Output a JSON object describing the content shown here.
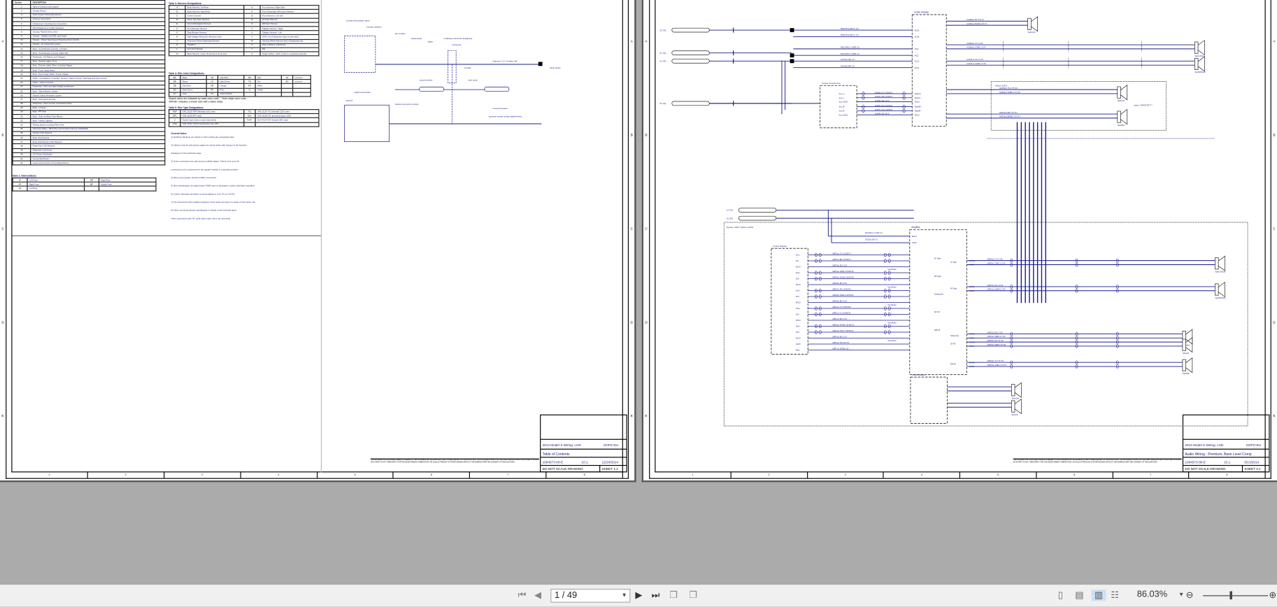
{
  "viewer": {
    "page_display": "1 / 49",
    "zoom": "86.03%"
  },
  "zones": [
    "1",
    "2",
    "3",
    "4",
    "5",
    "6",
    "7",
    "8"
  ],
  "rows": [
    "A",
    "B",
    "C",
    "D",
    "E"
  ],
  "sheet1": {
    "toc_headers": [
      "Section",
      "DESCRIPTION"
    ],
    "toc": [
      [
        "1",
        "Table of Contents and Legend"
      ],
      [
        "2",
        "Change History"
      ],
      [
        "3",
        "Audio System Wiring (all options)"
      ],
      [
        "5",
        "Antenna connections"
      ],
      [
        "6",
        "Infotainment main/Antenna connections"
      ],
      [
        "7",
        "MCU/Infotainment vehicle interfaces"
      ],
      [
        "8",
        "Security, Passive Entry, Horn"
      ],
      [
        "9",
        "Chassis - Stability and ABS, park brake"
      ],
      [
        "10",
        "Chassis - Power Steering and Steering wheel controls"
      ],
      [
        "11",
        "Chassis - Air suspension system"
      ],
      [
        "12",
        "Body - Door/Window Controls, Left Side"
      ],
      [
        "14",
        "Body - Door/Window Controls, Right Side"
      ],
      [
        "16",
        "Powertrain - HV Battery and Chargers"
      ],
      [
        "17",
        "Body - Exterior Lights, Front"
      ],
      [
        "18",
        "Body - Exterior Lights, Rear, including Tailgate"
      ],
      [
        "19",
        "Body - Front Cargo Hatch"
      ],
      [
        "20",
        "Body - Rear Cargo Hatch / Power Liftgate"
      ],
      [
        "21",
        "HVAC - Foundations: Controller, Sensors, Valves, Pumps, Solenoids and Inlet Louvers"
      ],
      [
        "22",
        "HVAC - Cabin Functions"
      ],
      [
        "24",
        "Powertrain - HVIL and High Voltage architecture"
      ],
      [
        "25",
        "Body - Wiper/Washer System"
      ],
      [
        "26",
        "Passive Safety Restraints System"
      ],
      [
        "27",
        "Body - Panoramic Sunroof"
      ],
      [
        "28",
        "Powertrain - Drive Inverter, Accelerator Pedal"
      ],
      [
        "29",
        "Body - LF Seat"
      ],
      [
        "30",
        "Body - RF Seat"
      ],
      [
        "31",
        "Body - Side and Rear View Mirrors"
      ],
      [
        "32",
        "Body - Interior Lighting"
      ],
      [
        "33",
        "Parking System including Rear View"
      ],
      [
        "34",
        "Advanced Safety - Blind Zone and Forward Camera, Park/Radar"
      ],
      [
        "35",
        "Chassis CAN Network"
      ],
      [
        "36",
        "Body CAN Network"
      ],
      [
        "37",
        "Body Fault/Tolerant CAN Network"
      ],
      [
        "38",
        "PowerTrain CAN Network"
      ],
      [
        "39",
        "Diagnostic Connectors"
      ],
      [
        "40",
        "12V Power Distribution"
      ],
      [
        "42",
        "Ground Distribution"
      ],
      [
        "43",
        "Layout and Function of Fuse/Relay Boxes"
      ]
    ],
    "abbr_caption": "Table 2: Abbreviations",
    "abbr": [
      [
        "LF",
        "Left Front",
        "RR",
        "Right Rear"
      ],
      [
        "RF",
        "Right Front",
        "MF",
        "Middle Front"
      ],
      [
        "LR",
        "Left Rear",
        "",
        ""
      ]
    ],
    "harness_caption": "Table 3: Harness Designations",
    "harness": [
      [
        "A",
        "Body Harness, Left Rear",
        "N",
        "Front Harness, Right Side"
      ],
      [
        "B",
        "Body Harness, Right Rear",
        "P",
        "Front Passenger (RF) Door Harness"
      ],
      [
        "C",
        "Center Console",
        "Q",
        "Front Harness, Left side"
      ],
      [
        "D",
        "Driver (LF) Door Harness",
        "R",
        "LR Door Harness"
      ],
      [
        "E",
        "Sunroof/Sideglass Harness",
        "S",
        "RR Door Harness"
      ],
      [
        "F",
        "Front Bumper Harness",
        "T",
        "Tailgate Harness - Right"
      ],
      [
        "G",
        "Rear Bumper Harness",
        "U",
        "Tailgate Harness - Left"
      ],
      [
        "H",
        "High Voltage Wiring (for reference only)",
        "V",
        "HVAC Unit Subharness (part of assembly)"
      ],
      [
        "J",
        "Instrument Panel (Dashpad) Harness",
        "W",
        "Steering Wheel Harness (from Clockspring out)"
      ],
      [
        "K",
        "Headliner",
        "X",
        "Rear subframe subharness"
      ],
      [
        "L",
        "Front End Module",
        "Y",
        "Bat"
      ],
      [
        "M",
        "Main Harness, Lower IP and Front Trunk area",
        "Z",
        "Single Cables - Each circuit in a separate assembly"
      ]
    ],
    "color_caption": "Table 4: Wire Color Designations",
    "colors": [
      [
        "BK",
        "Black",
        "LB",
        "Light Blue",
        "RD",
        "Red",
        "VA",
        "xxxxxxxx"
      ],
      [
        "BR",
        "Brown",
        "LG",
        "Light Green",
        "TN",
        "Tan",
        "SH",
        "xxxxxxxx"
      ],
      [
        "DB",
        "Dark Blue",
        "OR",
        "Orange",
        "WT",
        "White",
        "",
        ""
      ],
      [
        "DG",
        "Dark Green",
        "PK",
        "Pink",
        "YL",
        "Yellow",
        "",
        ""
      ],
      [
        "GY",
        "Gray",
        "VT",
        "Violet (Purple)",
        "",
        "",
        "",
        ""
      ]
    ],
    "stripe_note": [
      "Striped wires are indicated by base-color code \"-\" then stripe color code.",
      "\"BR-BK\" indicates a brown wire with a black stripe."
    ],
    "tags_caption": "Table 5: Wire Type Designations",
    "tags": [
      [
        "TWP",
        "SAE J1128 TWP (thinwall) 105C rated",
        "TXL",
        "SAE J1128 TXL (thinwall) 125C rated"
      ],
      [
        "SPC",
        "SAE J1128 SPC rated",
        "GXL",
        "SAE J1128 GXL general purpose 125C"
      ],
      [
        "S",
        "Double layer (twist on pair) braid shield",
        "FLRY",
        "ISO 6722 FLRY thinwall 105C rated"
      ],
      [
        "CAN",
        "SAE J2411 CAN-B specification wire, 85C",
        "",
        ""
      ]
    ],
    "notes_title": "General Notes",
    "notes": [
      "1) Switches (Relays) are shown in their resting (de-energized) state.",
      "2) Options may be split across pages for visual clarity with respect to the function",
      "    displayed on the particular page.",
      "3) Some connectors are split across multiple pages. Check to be sure all",
      "    connectors to be connected for the signals needed in a specific problem.",
      "4) Wire cross-section (mm2) to AWG conversion:",
      "5) Wire identification for twisted pair (TWP) type or equivalent, unless otherwise specified.",
      "6) Unless otherwise specified, terminal plating is to be Tin on Tin/Tin.",
      "7) For connectors with multiple instances of the same pin plug in a cavity on the same row.",
      "8) Inline connector gender specification is based on the terminal types.",
      "    Inline connectors with \"M\" suffix have male, tab or pin terminals."
    ],
    "legend": [
      "module description name",
      "module (outline)",
      "pin number",
      "twisted pair",
      "splice",
      "multiway connector designator",
      "connector",
      "module",
      "Harness C-C: N-Inline Tail",
      "inline splice",
      "shield connection",
      "Global connector number",
      "circuit number",
      "wire color",
      "Ground location",
      "ground",
      "optional content inside dashed lines"
    ],
    "title_block": {
      "project": "2013 Model S Wiring: LHD",
      "model": "SOP2+EU",
      "subject": "Table of Contents",
      "doc": "1004573-00-E",
      "rev": "10.1",
      "date": "12/24/2014",
      "noscale": "DO NOT SCALE DRAWING",
      "sheet": "SHEET 1.1"
    },
    "disclaimer": "THE INFORMATION CONTAINED HEREIN IS DEEMED TO BE CONFIDENTIAL, PROPRIETARY, AND A TRADE SECRET OF TESLA MOTORS. THIS INFORMATION MAY NOT BE USED, REPRODUCED, DISCLOSED IN WHOLE OR IN PART TO ANY THIRD PARTY FOR THE DEVELOPMENT, FABRICATION, OR SALE OF PRODUCTS OR PROCESSES WITHOUT THE EXPRESS WRITTEN CONSENT OF TESLA MOTORS."
  },
  "sheet3": {
    "title_block": {
      "project": "2013 Model S Wiring: LHD",
      "model": "SOP2+EU",
      "subject": "Audio Wiring - Premium, Base Level Comp",
      "doc": "1004573-00-E",
      "rev": "10.1",
      "date": "5/13/2014",
      "noscale": "DO NOT SCALE DRAWING",
      "sheet": "SHEET 3.1"
    },
    "center_display": "Center Display",
    "cd_pins": [
      "KL30",
      "KL30",
      "ACC",
      "ACC",
      "KL31",
      "KL31"
    ],
    "cd_wires": [
      "PRW70x1 RD/YL 3.0",
      "PRW70x2 RD/YL 3.0",
      "PACC84x1 YL/BR 3.0",
      "PACC84x2 YL/BR 3.0",
      "GGC8x1 BK 3.0",
      "GGC8x2 BK 3.0"
    ],
    "power_conns": [
      "X1.7(F)",
      "X1.7(F)",
      "X1.7(F)",
      "X1.7(F)"
    ],
    "aux_box": "Center Console Aux",
    "aux_pins": [
      "Aux_L+",
      "Aux_L-",
      "Aux_SHLD",
      "Aux_R+",
      "Aux_R-",
      "Aux_SHLD"
    ],
    "radio_pins": [
      "Radio1+",
      "Radio1-",
      "SHLD",
      "RadioR+",
      "RadioR-",
      "SHLD"
    ],
    "aux_wires": [
      "AUD03x1 GY 0.35 BST1",
      "AUD04x1 BR 0.35 BST1",
      "AUD05x1 BK 0.5 33",
      "AUD06x1 BU 0.35 BST2",
      "AUD07x1 OG 0.35 BST2",
      "AUD08x1 BK 0.5 33"
    ],
    "spk_top_wires": [
      "AUD09x1 PK 0.75 T3",
      "AUD09x1 PK/BK 0.75 T3",
      "AUD09x1 VT 1.0 T8",
      "AUD09x1 VT/BK 1.0 T8",
      "AUD11x1 OG 1.0 T8",
      "AUD11x1 OG/BK 1.0 T8",
      "AMP09x1 TN 0.75 T15",
      "AMP09x1 TN/BK 0.75 T15",
      "AMP10x1 BR 0.75 T17",
      "AMP10x1 BR/BK 0.75 T17"
    ],
    "speakers_top": [
      "SpkrCFL",
      "SpkrLFDoor",
      "SpkrRFDoor",
      "SpkrLFT",
      "SpkrRFT"
    ],
    "label_note": "Label: \"SPKR RF T\"",
    "option_box": "Option: AUD1",
    "system_box": "System: ASP / Option: AUD1",
    "amp_title": "Amplifier",
    "amp_power": [
      "BATT",
      "GND"
    ],
    "amp_power_wires": [
      "PACC84x1 YL/RD 3.0",
      "GGC8x1 BK 3.0"
    ],
    "cd2_title": "Center Display",
    "cd2_pins": [
      "Ch1+",
      "Ch1-",
      "SHLD",
      "Ch2+",
      "Ch2-",
      "SHLD",
      "Ch3+",
      "Ch3-",
      "SHLD",
      "Ch4+",
      "Ch4-",
      "SHLD",
      "Ch5+",
      "Ch5-",
      "SHLD",
      "OnOff",
      "Mute"
    ],
    "amp_wires": [
      "AMP01x1 GY 0.35 BST17",
      "AMP02x1 BR 0.35 BST17",
      "AMP03x1 BK 0.5 33",
      "AMP04x1 LB/BK 0.35 BST18",
      "AMP05x1 OG/LB 0.35 BST18",
      "AMP06x1 BK 0.5 33",
      "AMP07x1 PK 0.35 BST19",
      "AMP08x1 PK/BK 0.35 BST19",
      "AMP09x1 BK 0.5 33",
      "AMP10x1 VT 0.35 BST20",
      "AMP11x1 YL 0.35 BST20",
      "AMP12x1 BK 0.5 33",
      "AMP13x1 WT/BK 0.35 BST21",
      "AMP14x1 OG/YL 0.35 BST21",
      "AMP15x1 BK 0.5 37",
      "AMP16x1 WT/OG 0.35",
      "AMP17x1 WT/BK 0.35"
    ],
    "amp_groups": [
      "LF Spkr",
      "RF Spkr",
      "Subwoofer",
      "LR Fill",
      "RR Fill"
    ],
    "open_shield": "OpenShield",
    "amp_outs": [
      "OUT1+",
      "OUT1-",
      "OUT2+",
      "OUT2-",
      "OUT3+",
      "OUT3-",
      "OUT4+",
      "OUT4-",
      "OUT5+",
      "OUT5-"
    ],
    "out_wires": [
      "AMP20x1 VT 1.0 T18",
      "AMP20x1 VT/BK 1.0 T18",
      "AMP21x1 OG 1.0 T19",
      "AMP21x1 OG/BK 1.0 T19",
      "AMP22x1 DB 2.0 T20",
      "AMP22x1 DB/BK 2.0 T20",
      "AMP23x1 LB 0.75 T21",
      "AMP23x1 LB/BK 0.75 T21",
      "AMP24x1 LG 0.75 T22",
      "AMP24x1 LG/BK 0.75 T22"
    ],
    "speakers_bottom": [
      "SpkrLFDoor",
      "SpkrRFDoor",
      "SpkrSub",
      "SpkrLR",
      "SpkrRR"
    ],
    "sub_box": "Center Display",
    "wire_color": "#1a1a8c"
  }
}
